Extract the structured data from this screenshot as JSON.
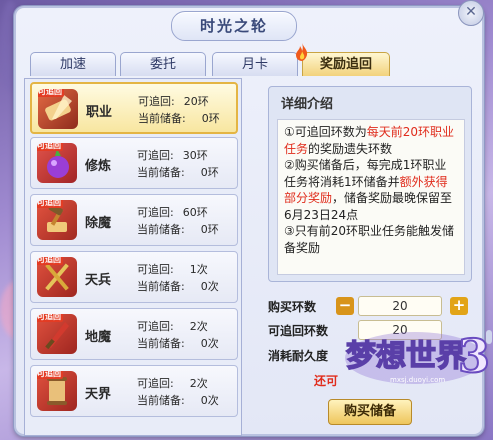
{
  "window": {
    "title": "时光之轮"
  },
  "tabs": [
    {
      "label": "加速"
    },
    {
      "label": "委托"
    },
    {
      "label": "月卡"
    },
    {
      "label": "奖励追回"
    }
  ],
  "tasks": [
    {
      "name": "职业",
      "recoverable_label": "可追回:",
      "recoverable": "20环",
      "stored_label": "当前储备:",
      "stored": "0环",
      "icon": "scroll-quill-icon",
      "color": "#c9412d"
    },
    {
      "name": "修炼",
      "recoverable_label": "可追回:",
      "recoverable": "30环",
      "stored_label": "当前储备:",
      "stored": "0环",
      "icon": "purple-gourd-icon",
      "color": "#8a3fc7"
    },
    {
      "name": "除魔",
      "recoverable_label": "可追回:",
      "recoverable": "60环",
      "stored_label": "当前储备:",
      "stored": "0环",
      "icon": "hammer-scroll-icon",
      "color": "#c47a2a"
    },
    {
      "name": "天兵",
      "recoverable_label": "可追回:",
      "recoverable": "1次",
      "stored_label": "当前储备:",
      "stored": "0次",
      "icon": "crossed-swords-icon",
      "color": "#b8962f"
    },
    {
      "name": "地魔",
      "recoverable_label": "可追回:",
      "recoverable": "2次",
      "stored_label": "当前储备:",
      "stored": "0次",
      "icon": "red-blade-icon",
      "color": "#c0302a"
    },
    {
      "name": "天界",
      "recoverable_label": "可追回:",
      "recoverable": "2次",
      "stored_label": "当前储备:",
      "stored": "0次",
      "icon": "rolled-scroll-icon",
      "color": "#b67e3a"
    }
  ],
  "badge_text": "可追回",
  "detail": {
    "title": "详细介绍",
    "line1_a": "①可追回环数为",
    "line1_red": "每天前20环职业任务",
    "line1_b": "的奖励遗失环数",
    "line2_a": "②购买储备后，每完成1环职业任务将消耗1环储备并",
    "line2_red": "额外获得部分奖励",
    "line2_b": "，储备奖励最晚保留至6月23日24点",
    "line3": "③只有前20环职业任务能触发储备奖励"
  },
  "form": {
    "buy_count_label": "购买环数",
    "buy_count": "20",
    "recoverable_label": "可追回环数",
    "recoverable": "20",
    "cost_label": "消耗耐久度",
    "recover_text": "还可",
    "buy_button": "购买储备"
  },
  "logo": {
    "main": "梦想世界",
    "number": "3",
    "url": "mxsj.duoyi.com"
  },
  "colors": {
    "accent_gold": "#f2d27c",
    "red_text": "#e02c1c",
    "plus": "#e2a417",
    "minus": "#d8941a"
  }
}
